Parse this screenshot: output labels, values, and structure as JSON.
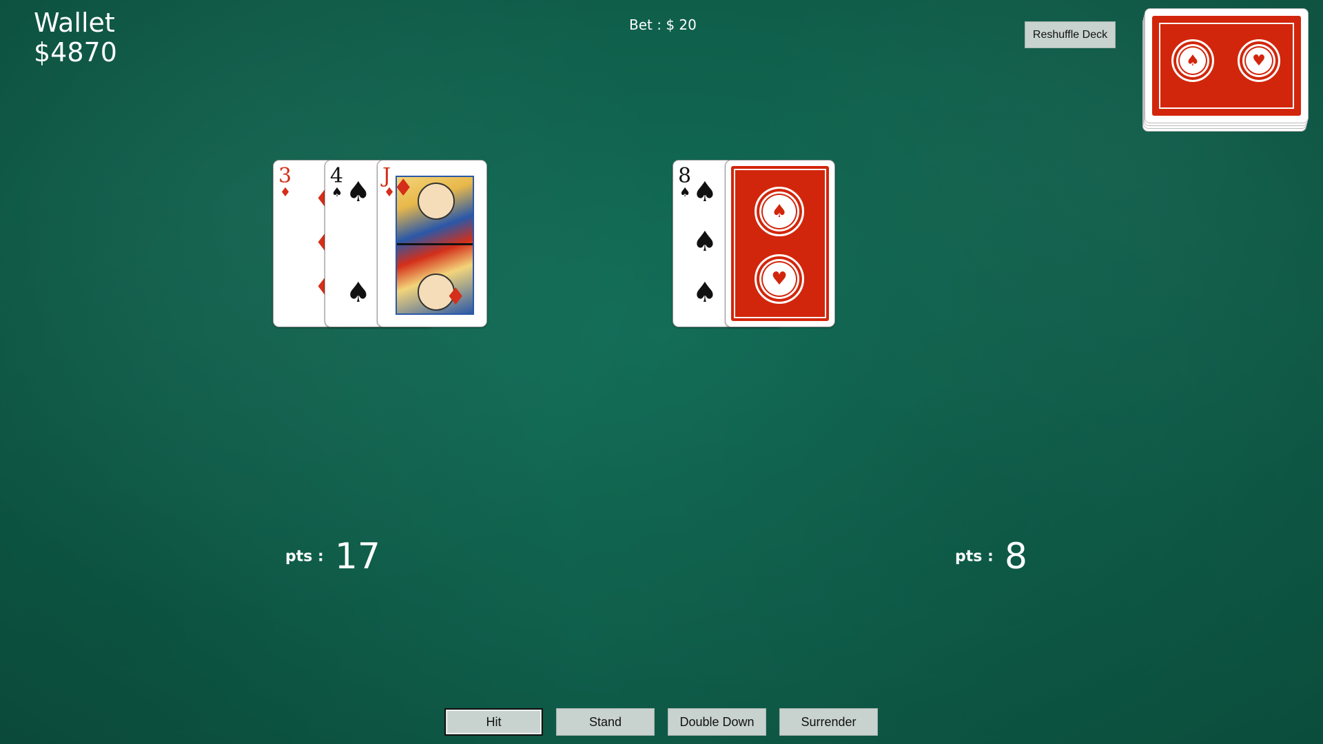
{
  "wallet": {
    "label": "Wallet",
    "amount": "$4870"
  },
  "bet": {
    "text": "Bet : $ 20"
  },
  "reshuffle_label": "Reshuffle Deck",
  "player": {
    "cards": [
      {
        "rank": "3",
        "suit": "♦",
        "color": "red"
      },
      {
        "rank": "4",
        "suit": "♠",
        "color": "black"
      },
      {
        "rank": "J",
        "suit": "♦",
        "color": "red"
      }
    ],
    "pts_label": "pts :",
    "pts_value": "17"
  },
  "dealer": {
    "cards": [
      {
        "rank": "8",
        "suit": "♠",
        "color": "black"
      },
      {
        "rank": "",
        "suit": "",
        "color": "back"
      }
    ],
    "pts_label": "pts :",
    "pts_value": "8"
  },
  "actions": {
    "hit": "Hit",
    "stand": "Stand",
    "double_down": "Double Down",
    "surrender": "Surrender"
  },
  "colors": {
    "table": "#0f5f4b",
    "card_back": "#d2260c",
    "button": "#c8d2cf"
  }
}
